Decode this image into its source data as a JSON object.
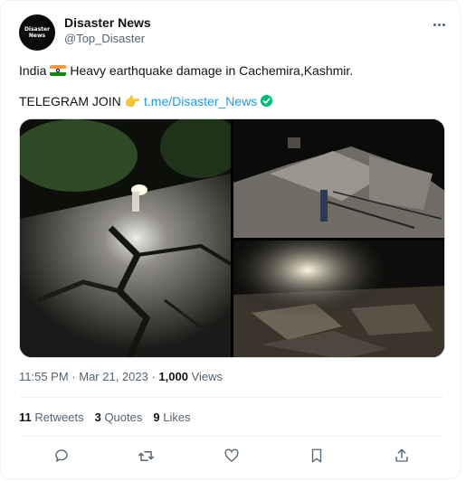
{
  "author": {
    "name": "Disaster News",
    "handle": "@Top_Disaster",
    "avatar_text": [
      "Disaster",
      "News"
    ]
  },
  "tweet": {
    "line1_prefix": "India",
    "line1_flag": "flag-india-icon",
    "line1_rest": "Heavy earthquake damage in Cachemira,Kashmir.",
    "line2_prefix": "TELEGRAM JOIN 👉",
    "line2_link": "t.me/Disaster_News"
  },
  "meta": {
    "time": "11:55 PM",
    "date": "Mar 21, 2023",
    "views_count": "1,000",
    "views_label": "Views"
  },
  "stats": {
    "retweets_count": "11",
    "retweets_label": "Retweets",
    "quotes_count": "3",
    "quotes_label": "Quotes",
    "likes_count": "9",
    "likes_label": "Likes"
  },
  "colors": {
    "link": "#1d9bf0",
    "muted": "#536471",
    "text": "#0f1419",
    "divider": "#eff3f4"
  }
}
